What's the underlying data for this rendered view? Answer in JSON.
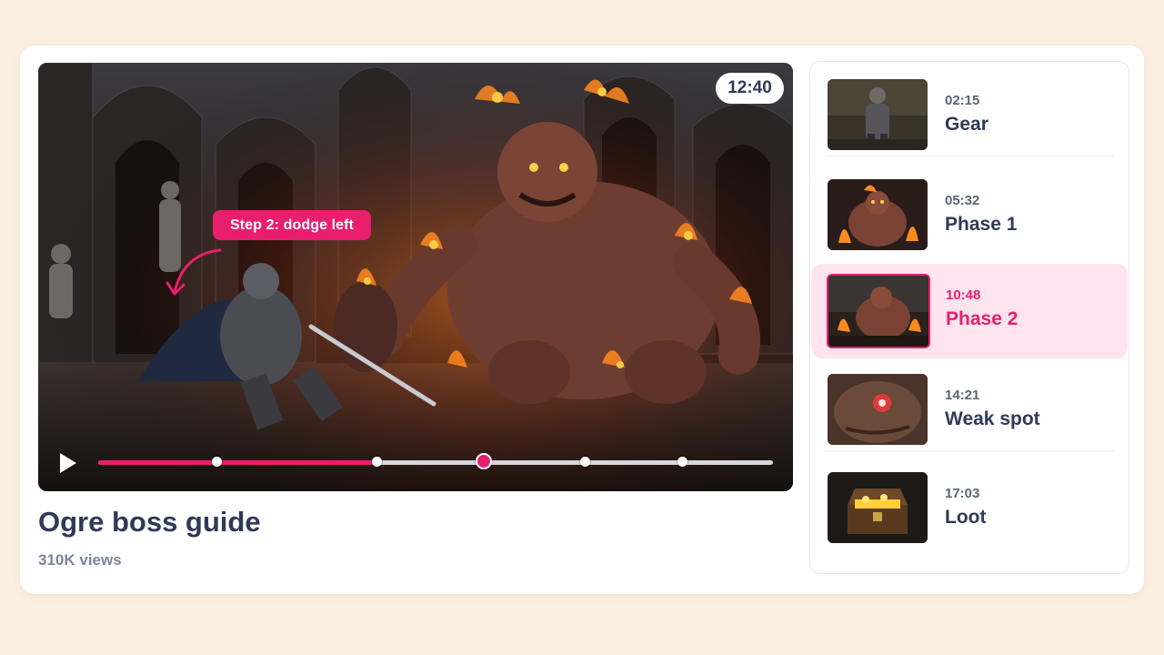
{
  "player": {
    "current_time": "12:40",
    "annotation": "Step 2: dodge left",
    "progress": 0.41,
    "chapter_markers": [
      0.177,
      0.414,
      0.572,
      0.722,
      0.866
    ],
    "active_marker_index": 2
  },
  "video": {
    "title": "Ogre boss guide",
    "views": "310K views"
  },
  "chapters": [
    {
      "time": "02:15",
      "label": "Gear",
      "active": false,
      "thumb": "knight-standing"
    },
    {
      "time": "05:32",
      "label": "Phase 1",
      "active": false,
      "thumb": "ogre-flames"
    },
    {
      "time": "10:48",
      "label": "Phase 2",
      "active": true,
      "thumb": "ogre-charge"
    },
    {
      "time": "14:21",
      "label": "Weak spot",
      "active": false,
      "thumb": "ogre-eye"
    },
    {
      "time": "17:03",
      "label": "Loot",
      "active": false,
      "thumb": "treasure-chest"
    }
  ],
  "colors": {
    "accent": "#e91e6d",
    "title": "#2e3a57",
    "background": "#fcefe2"
  }
}
